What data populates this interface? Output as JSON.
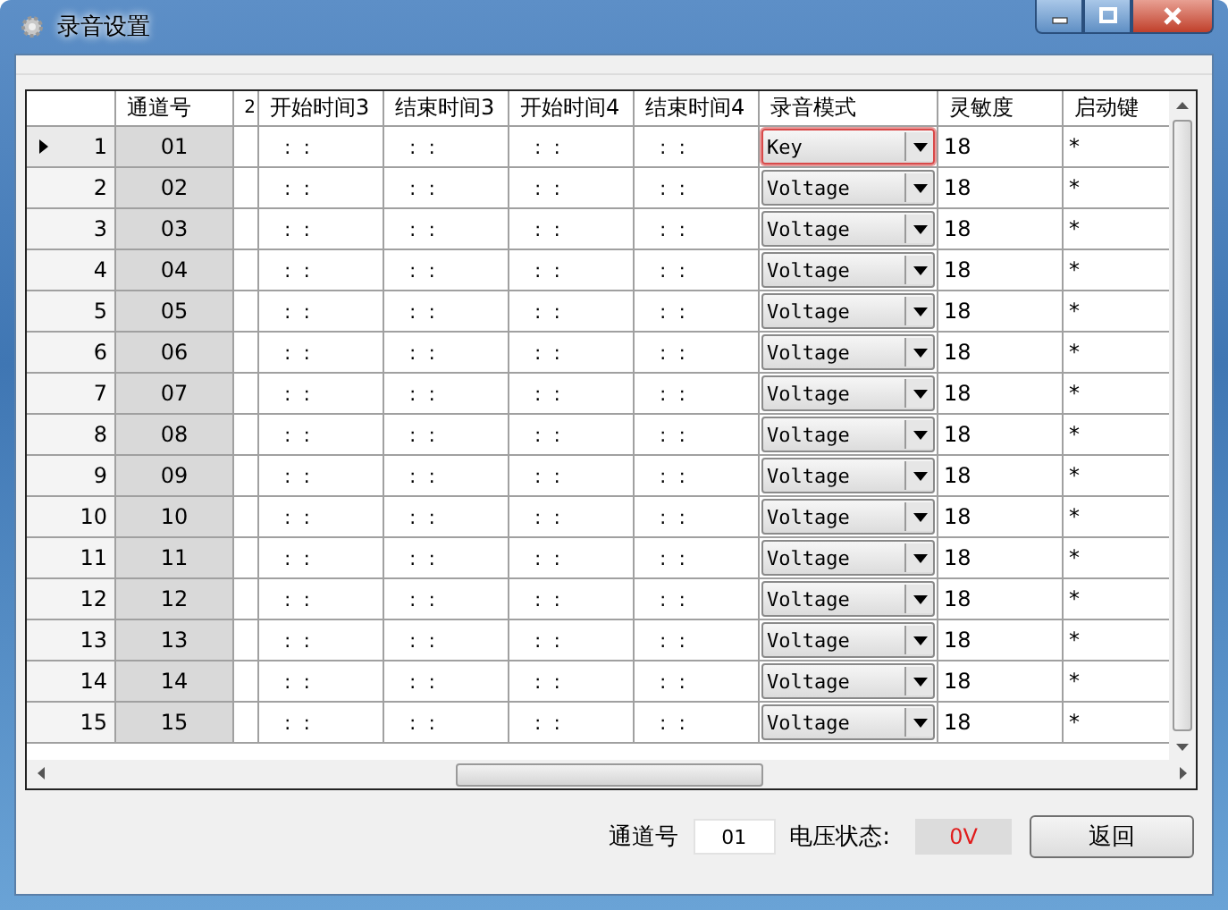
{
  "window": {
    "title": "录音设置"
  },
  "table": {
    "columns": [
      "通道号",
      "2",
      "开始时间3",
      "结束时间3",
      "开始时间4",
      "结束时间4",
      "录音模式",
      "灵敏度",
      "启动键"
    ],
    "rows": [
      {
        "index": "1",
        "channel": "01",
        "times": [
          ":  :",
          ":  :",
          ":  :",
          ":  :"
        ],
        "mode": "Key",
        "focused": true,
        "sensitivity": "18",
        "key": "*",
        "selected": true
      },
      {
        "index": "2",
        "channel": "02",
        "times": [
          ":  :",
          ":  :",
          ":  :",
          ":  :"
        ],
        "mode": "Voltage",
        "focused": false,
        "sensitivity": "18",
        "key": "*",
        "selected": false
      },
      {
        "index": "3",
        "channel": "03",
        "times": [
          ":  :",
          ":  :",
          ":  :",
          ":  :"
        ],
        "mode": "Voltage",
        "focused": false,
        "sensitivity": "18",
        "key": "*",
        "selected": false
      },
      {
        "index": "4",
        "channel": "04",
        "times": [
          ":  :",
          ":  :",
          ":  :",
          ":  :"
        ],
        "mode": "Voltage",
        "focused": false,
        "sensitivity": "18",
        "key": "*",
        "selected": false
      },
      {
        "index": "5",
        "channel": "05",
        "times": [
          ":  :",
          ":  :",
          ":  :",
          ":  :"
        ],
        "mode": "Voltage",
        "focused": false,
        "sensitivity": "18",
        "key": "*",
        "selected": false
      },
      {
        "index": "6",
        "channel": "06",
        "times": [
          ":  :",
          ":  :",
          ":  :",
          ":  :"
        ],
        "mode": "Voltage",
        "focused": false,
        "sensitivity": "18",
        "key": "*",
        "selected": false
      },
      {
        "index": "7",
        "channel": "07",
        "times": [
          ":  :",
          ":  :",
          ":  :",
          ":  :"
        ],
        "mode": "Voltage",
        "focused": false,
        "sensitivity": "18",
        "key": "*",
        "selected": false
      },
      {
        "index": "8",
        "channel": "08",
        "times": [
          ":  :",
          ":  :",
          ":  :",
          ":  :"
        ],
        "mode": "Voltage",
        "focused": false,
        "sensitivity": "18",
        "key": "*",
        "selected": false
      },
      {
        "index": "9",
        "channel": "09",
        "times": [
          ":  :",
          ":  :",
          ":  :",
          ":  :"
        ],
        "mode": "Voltage",
        "focused": false,
        "sensitivity": "18",
        "key": "*",
        "selected": false
      },
      {
        "index": "10",
        "channel": "10",
        "times": [
          ":  :",
          ":  :",
          ":  :",
          ":  :"
        ],
        "mode": "Voltage",
        "focused": false,
        "sensitivity": "18",
        "key": "*",
        "selected": false
      },
      {
        "index": "11",
        "channel": "11",
        "times": [
          ":  :",
          ":  :",
          ":  :",
          ":  :"
        ],
        "mode": "Voltage",
        "focused": false,
        "sensitivity": "18",
        "key": "*",
        "selected": false
      },
      {
        "index": "12",
        "channel": "12",
        "times": [
          ":  :",
          ":  :",
          ":  :",
          ":  :"
        ],
        "mode": "Voltage",
        "focused": false,
        "sensitivity": "18",
        "key": "*",
        "selected": false
      },
      {
        "index": "13",
        "channel": "13",
        "times": [
          ":  :",
          ":  :",
          ":  :",
          ":  :"
        ],
        "mode": "Voltage",
        "focused": false,
        "sensitivity": "18",
        "key": "*",
        "selected": false
      },
      {
        "index": "14",
        "channel": "14",
        "times": [
          ":  :",
          ":  :",
          ":  :",
          ":  :"
        ],
        "mode": "Voltage",
        "focused": false,
        "sensitivity": "18",
        "key": "*",
        "selected": false
      },
      {
        "index": "15",
        "channel": "15",
        "times": [
          ":  :",
          ":  :",
          ":  :",
          ":  :"
        ],
        "mode": "Voltage",
        "focused": false,
        "sensitivity": "18",
        "key": "*",
        "selected": false
      }
    ]
  },
  "footer": {
    "channel_label": "通道号",
    "channel_value": "01",
    "voltage_label": "电压状态:",
    "voltage_value": "0V",
    "button": "返回"
  }
}
